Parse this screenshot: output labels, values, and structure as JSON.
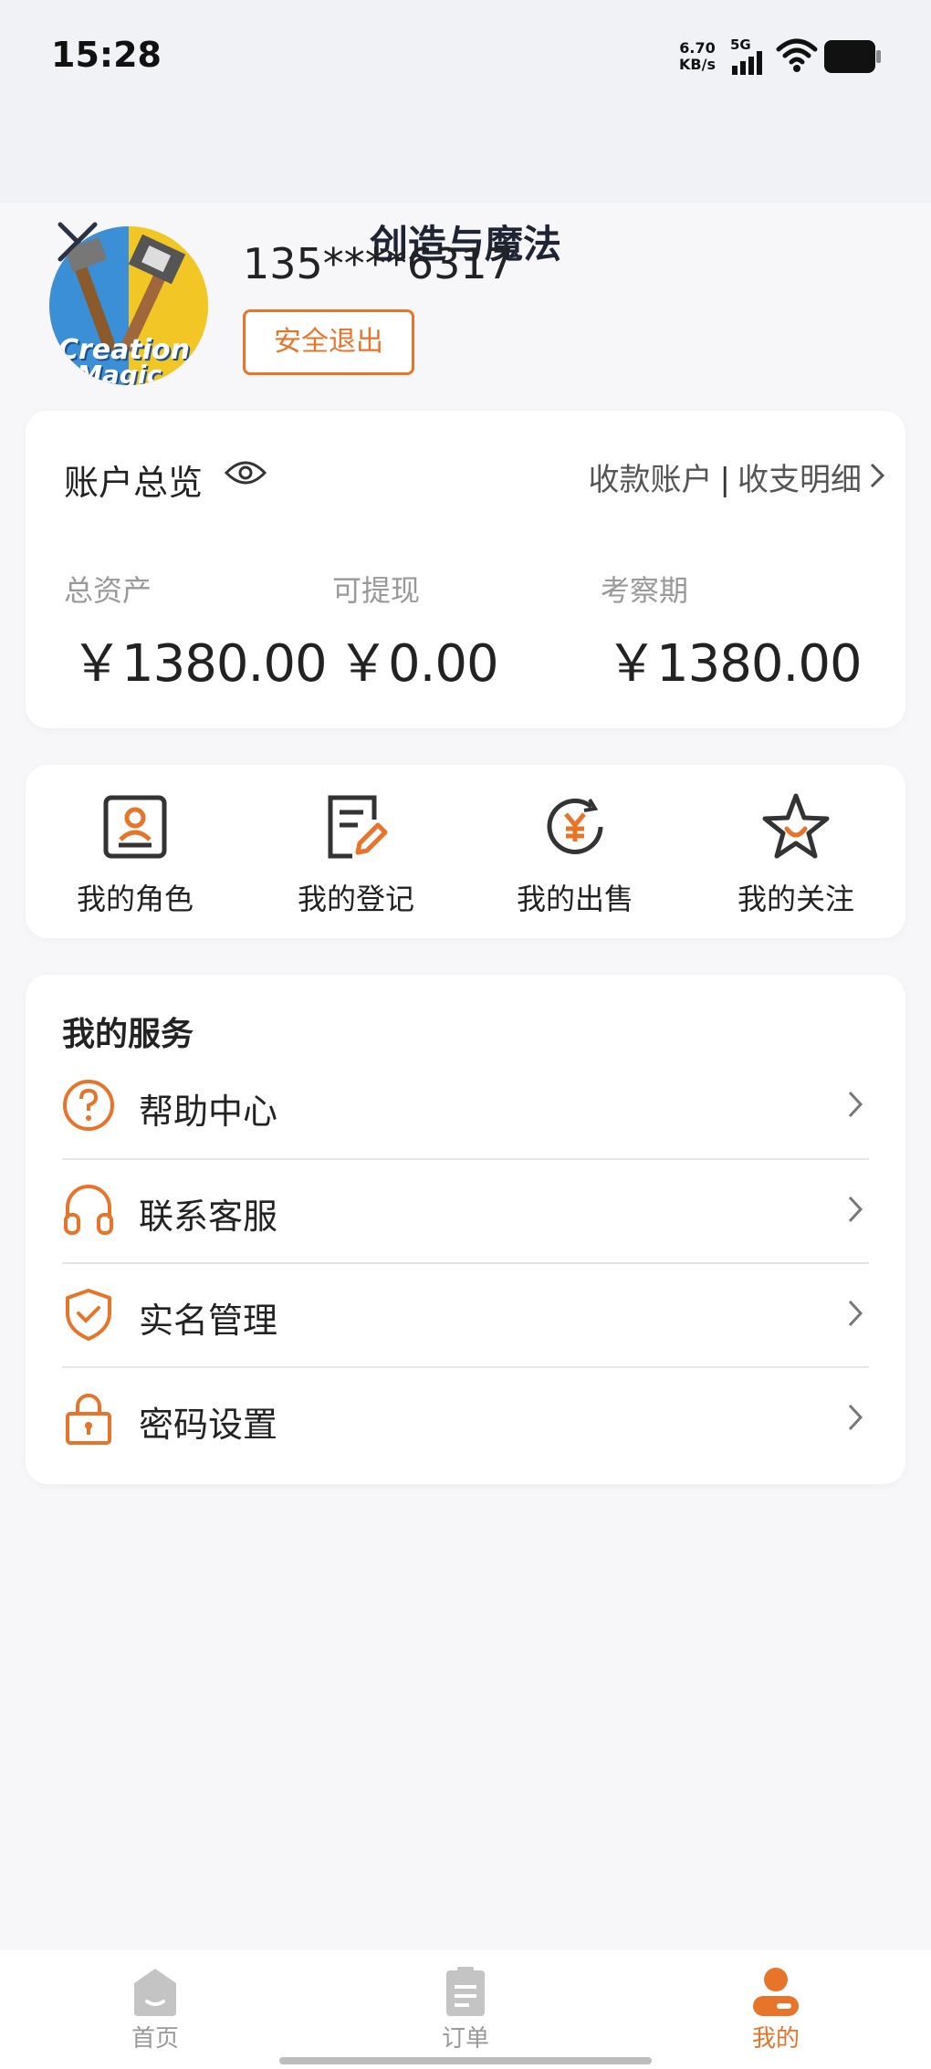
{
  "status_bar": {
    "time": "15:28",
    "net_speed_value": "6.70",
    "net_speed_unit": "KB/s",
    "network": "5G",
    "icons": [
      "signal-icon",
      "wifi-icon",
      "battery-icon"
    ]
  },
  "nav": {
    "title": "创造与魔法",
    "close_icon": "close-icon"
  },
  "profile": {
    "phone": "135****6317",
    "logout_label": "安全退出",
    "avatar_text_line1": "Creation",
    "avatar_text_line2": "Magic"
  },
  "account": {
    "title": "账户总览",
    "link_receive": "收款账户",
    "separator": "|",
    "link_details": "收支明细",
    "stats": [
      {
        "label": "总资产",
        "value": "￥1380.00"
      },
      {
        "label": "可提现",
        "value": "￥0.00"
      },
      {
        "label": "考察期",
        "value": "￥1380.00"
      }
    ]
  },
  "quick_actions": [
    {
      "label": "我的角色",
      "icon": "role-icon"
    },
    {
      "label": "我的登记",
      "icon": "register-icon"
    },
    {
      "label": "我的出售",
      "icon": "sell-icon"
    },
    {
      "label": "我的关注",
      "icon": "favorite-icon"
    }
  ],
  "services": {
    "title": "我的服务",
    "items": [
      {
        "label": "帮助中心",
        "icon": "help-icon"
      },
      {
        "label": "联系客服",
        "icon": "headset-icon"
      },
      {
        "label": "实名管理",
        "icon": "shield-check-icon"
      },
      {
        "label": "密码设置",
        "icon": "lock-icon"
      }
    ]
  },
  "tab_bar": {
    "tabs": [
      {
        "label": "首页",
        "icon": "home-icon",
        "active": false
      },
      {
        "label": "订单",
        "icon": "order-icon",
        "active": false
      },
      {
        "label": "我的",
        "icon": "profile-icon",
        "active": true
      }
    ]
  },
  "colors": {
    "accent": "#e8742a",
    "header_bg": "#f0f2f6",
    "page_bg": "#f7f7f9",
    "icon_dark": "#333333"
  }
}
